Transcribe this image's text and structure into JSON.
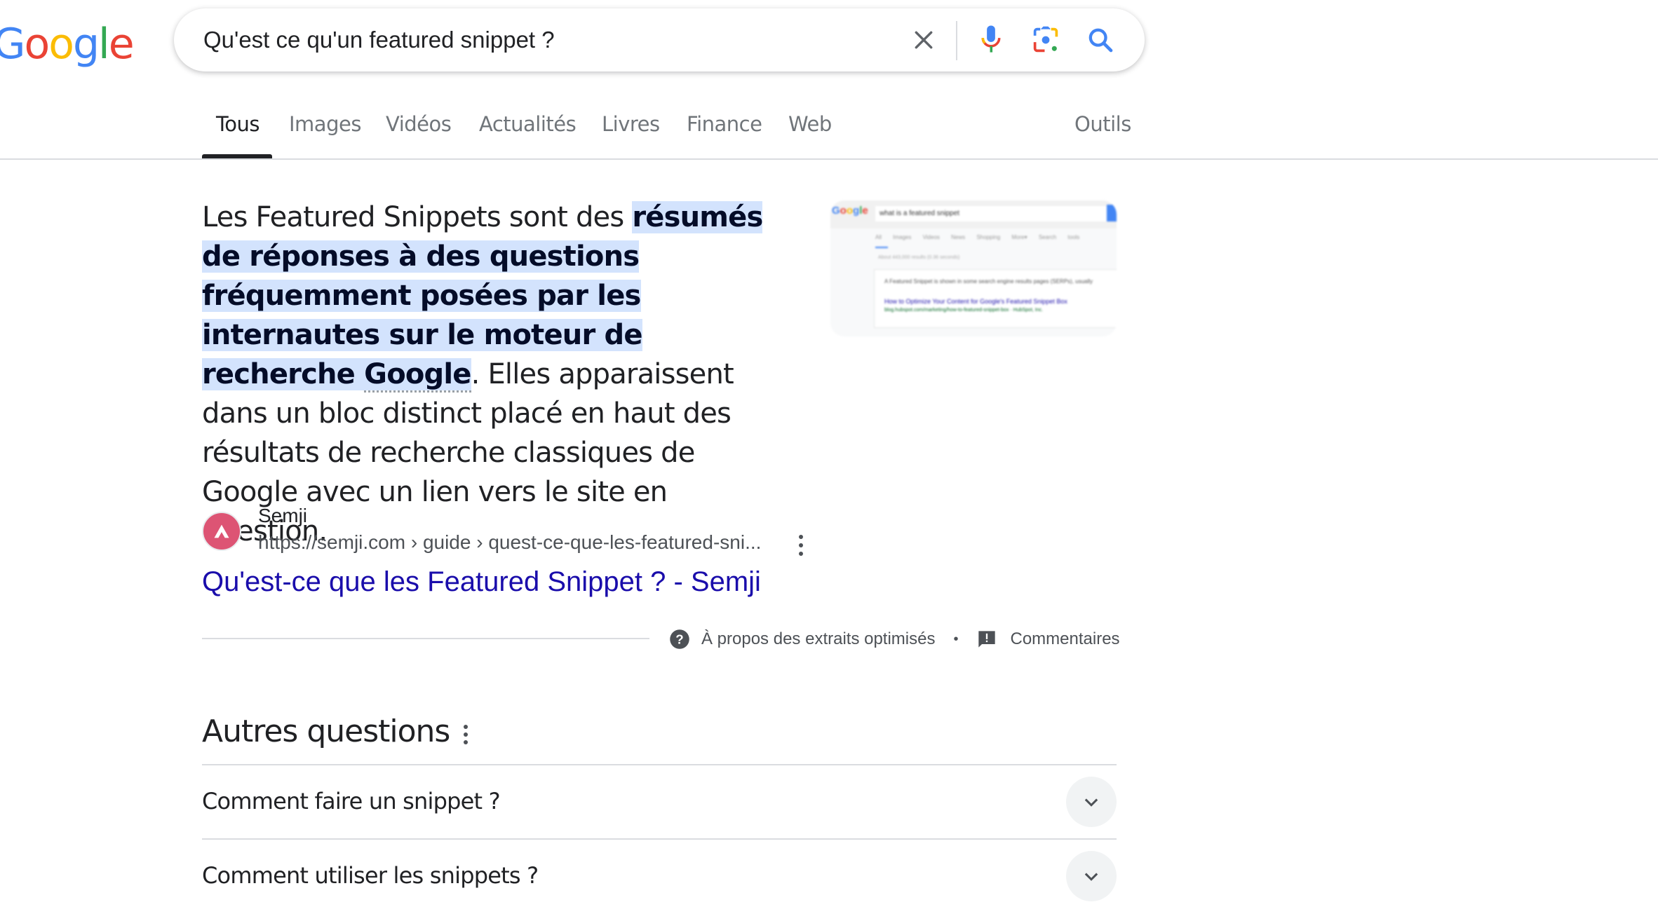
{
  "logo": {
    "letters": [
      "G",
      "o",
      "o",
      "g",
      "l",
      "e"
    ],
    "colors": [
      "#4285f4",
      "#ea4335",
      "#fbbc05",
      "#4285f4",
      "#34a853",
      "#ea4335"
    ]
  },
  "search": {
    "query": "Qu'est ce qu'un featured snippet ?"
  },
  "tabs": [
    {
      "label": "Tous",
      "active": true
    },
    {
      "label": "Images"
    },
    {
      "label": "Vidéos"
    },
    {
      "label": "Actualités"
    },
    {
      "label": "Livres"
    },
    {
      "label": "Finance"
    },
    {
      "label": "Web"
    }
  ],
  "tools_label": "Outils",
  "snippet": {
    "before": "Les Featured Snippets sont des ",
    "highlight_1": "résumés de réponses à des questions fréquemment posées par les internautes sur le moteur de recherche ",
    "highlight_2": "Google",
    "after": ". Elles apparaissent dans un bloc distinct placé en haut des résultats de recherche classiques de Google avec un lien vers le site en question."
  },
  "thumbnail": {
    "logo": "Google",
    "query": "what is a featured snippet",
    "tabs": "All Images Videos News Shopping More▾ Search tools",
    "count": "About 443,000 results (0.36 seconds)",
    "line1": "A Featured Snippet is shown in some search engine results pages (SERPs), usually",
    "link": "How to Optimize Your Content for Google's Featured Snippet Box",
    "url": "blog.hubspot.com/marketing/how-to-featured-snippet-box · HubSpot, Inc."
  },
  "source": {
    "name": "Semji",
    "url": "https://semji.com › guide › quest-ce-que-les-featured-sni...",
    "favicon_color": "#dd5474"
  },
  "result_title": "Qu'est-ce que les Featured Snippet ? - Semji",
  "footer": {
    "about_label": "À propos des extraits optimisés",
    "separator": "•",
    "feedback_label": "Commentaires"
  },
  "paa": {
    "title": "Autres questions",
    "items": [
      {
        "question": "Comment faire un snippet ?"
      },
      {
        "question": "Comment utiliser les snippets ?"
      }
    ]
  }
}
